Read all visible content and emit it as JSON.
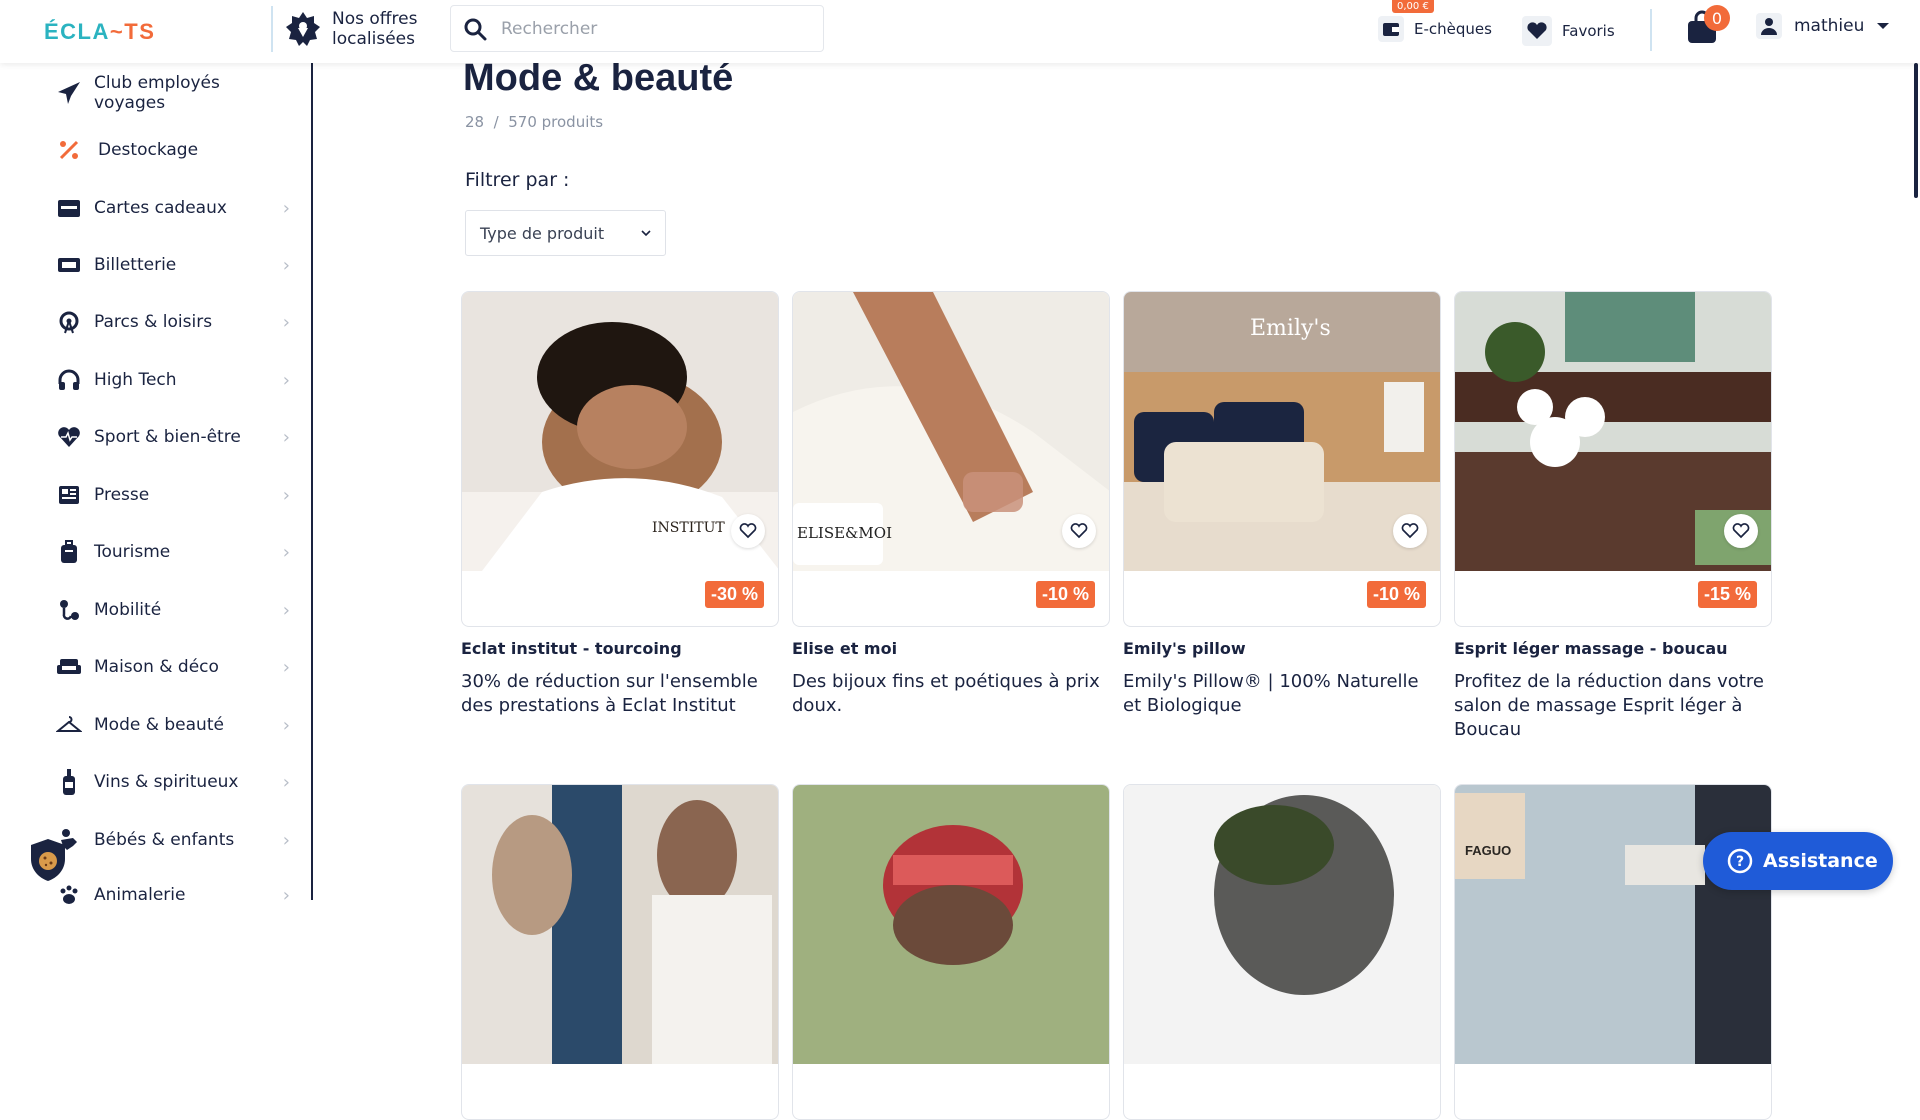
{
  "header": {
    "logo_left": "ÉCLA",
    "logo_mid": "~",
    "logo_right": "TS",
    "offers_line1": "Nos offres",
    "offers_line2": "localisées",
    "search_placeholder": "Rechercher",
    "echeques_badge": "0,00 €",
    "echeques_label": "E-chèques",
    "favoris_label": "Favoris",
    "cart_count": "0",
    "user_name": "mathieu"
  },
  "sidebar": {
    "items": [
      {
        "label": "Club employés voyages",
        "icon": "plane-icon"
      },
      {
        "label": "Destockage",
        "icon": "percent-icon"
      },
      {
        "label": "Cartes cadeaux",
        "icon": "gift-card-icon"
      },
      {
        "label": "Billetterie",
        "icon": "ticket-icon"
      },
      {
        "label": "Parcs & loisirs",
        "icon": "ferris-wheel-icon"
      },
      {
        "label": "High Tech",
        "icon": "headphones-icon"
      },
      {
        "label": "Sport & bien-être",
        "icon": "heart-pulse-icon"
      },
      {
        "label": "Presse",
        "icon": "newspaper-icon"
      },
      {
        "label": "Tourisme",
        "icon": "luggage-icon"
      },
      {
        "label": "Mobilité",
        "icon": "route-icon"
      },
      {
        "label": "Maison & déco",
        "icon": "sofa-icon"
      },
      {
        "label": "Mode & beauté",
        "icon": "hanger-icon"
      },
      {
        "label": "Vins & spiritueux",
        "icon": "bottle-icon"
      },
      {
        "label": "Bébés & enfants",
        "icon": "baby-icon"
      },
      {
        "label": "Animalerie",
        "icon": "paw-icon"
      }
    ]
  },
  "main": {
    "title": "Mode & beauté",
    "count_shown": "28",
    "count_sep": "/",
    "count_total": "570 produits",
    "filter_label": "Filtrer par :",
    "filter_select": "Type de produit"
  },
  "products": [
    {
      "name": "Eclat institut - tourcoing",
      "desc": "30% de réduction sur l'ensemble des prestations à Eclat Institut",
      "discount": "-30 %",
      "overlay": "INSTITUT"
    },
    {
      "name": "Elise et moi",
      "desc": "Des bijoux fins et poétiques à prix doux.",
      "discount": "-10 %",
      "overlay": "ELISE&MOI"
    },
    {
      "name": "Emily's pillow",
      "desc": "Emily's Pillow® | 100% Naturelle et Biologique",
      "discount": "-10 %",
      "overlay": "Emily's"
    },
    {
      "name": "Esprit léger massage - boucau",
      "desc": "Profitez de la réduction dans votre salon de massage Esprit léger à Boucau",
      "discount": "-15 %",
      "overlay": ""
    }
  ],
  "row2": [
    {
      "overlay": ""
    },
    {
      "overlay": ""
    },
    {
      "overlay": ""
    },
    {
      "overlay": "FAGUO"
    }
  ],
  "assistance_label": "Assistance",
  "colors": {
    "accent": "#f26b3a",
    "brand_teal": "#2bb3c0",
    "navy": "#1a2340",
    "assist_blue": "#1f5bd8"
  }
}
